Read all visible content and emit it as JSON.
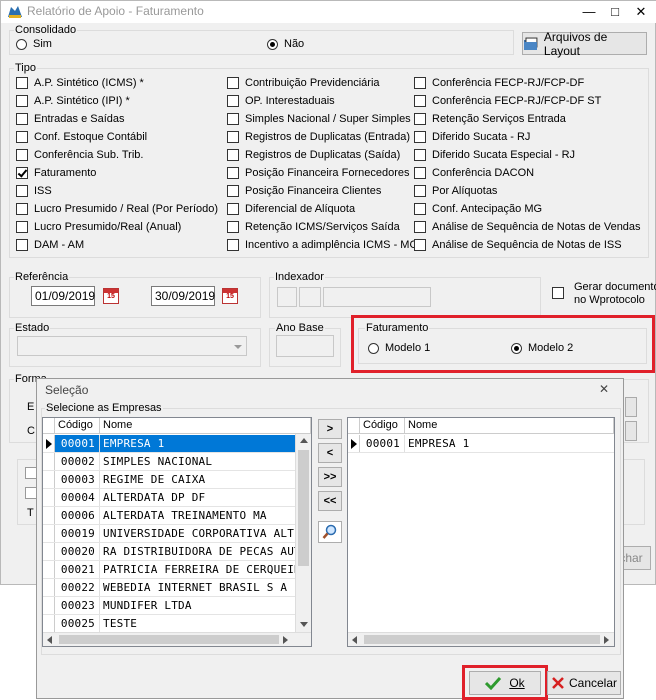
{
  "window": {
    "title": "Relatório de Apoio - Faturamento",
    "minimize": "—",
    "maximize": "□",
    "close": "✕"
  },
  "consolidado": {
    "legend": "Consolidado",
    "sim": "Sim",
    "nao": "Não",
    "selected": "nao"
  },
  "arquivos_button": "Arquivos de Layout",
  "tipo": {
    "legend": "Tipo",
    "col1": [
      {
        "label": "A.P. Sintético (ICMS) *",
        "checked": false
      },
      {
        "label": "A.P. Sintético (IPI) *",
        "checked": false
      },
      {
        "label": "Entradas e Saídas",
        "checked": false
      },
      {
        "label": "Conf. Estoque Contábil",
        "checked": false
      },
      {
        "label": "Conferência Sub. Trib.",
        "checked": false
      },
      {
        "label": "Faturamento",
        "checked": true
      },
      {
        "label": "ISS",
        "checked": false
      },
      {
        "label": "Lucro Presumido / Real (Por  Período)",
        "checked": false
      },
      {
        "label": "Lucro Presumido/Real (Anual)",
        "checked": false
      },
      {
        "label": "DAM - AM",
        "checked": false
      }
    ],
    "col2": [
      {
        "label": "Contribuição Previdenciária",
        "checked": false
      },
      {
        "label": "OP. Interestaduais",
        "checked": false
      },
      {
        "label": "Simples Nacional / Super Simples",
        "checked": false
      },
      {
        "label": "Registros de Duplicatas (Entrada)",
        "checked": false
      },
      {
        "label": "Registros de Duplicatas (Saída)",
        "checked": false
      },
      {
        "label": "Posição Financeira Fornecedores",
        "checked": false
      },
      {
        "label": "Posição Financeira Clientes",
        "checked": false
      },
      {
        "label": "Diferencial de Alíquota",
        "checked": false
      },
      {
        "label": "Retenção ICMS/Serviços Saída",
        "checked": false
      },
      {
        "label": "Incentivo a adimplência ICMS - MG",
        "checked": false
      }
    ],
    "col3": [
      {
        "label": "Conferência FECP-RJ/FCP-DF",
        "checked": false
      },
      {
        "label": "Conferência FECP-RJ/FCP-DF ST",
        "checked": false
      },
      {
        "label": "Retenção Serviços Entrada",
        "checked": false
      },
      {
        "label": "Diferido Sucata - RJ",
        "checked": false
      },
      {
        "label": "Diferido Sucata Especial - RJ",
        "checked": false
      },
      {
        "label": "Conferência DACON",
        "checked": false
      },
      {
        "label": "Por Alíquotas",
        "checked": false
      },
      {
        "label": "Conf. Antecipação MG",
        "checked": false
      },
      {
        "label": "Análise de Sequência de Notas de Vendas",
        "checked": false
      },
      {
        "label": "Análise de Sequência de Notas de ISS",
        "checked": false
      }
    ]
  },
  "referencia": {
    "legend": "Referência",
    "inicio": "01/09/2019",
    "fim": "30/09/2019",
    "cal_label": "15"
  },
  "indexador": {
    "legend": "Indexador"
  },
  "gerar": {
    "line1": "Gerar documento",
    "line2": "no Wprotocolo"
  },
  "estado": {
    "legend": "Estado"
  },
  "ano_base": {
    "legend": "Ano Base"
  },
  "faturamento": {
    "legend": "Faturamento",
    "modelo1": "Modelo 1",
    "modelo2": "Modelo 2",
    "selected": "modelo2"
  },
  "background_fragments": {
    "forma": "Forma",
    "e": "E",
    "c": "C",
    "t": "T",
    "fechar": "char"
  },
  "selecao": {
    "title": "Seleção",
    "close": "✕",
    "group": "Selecione as Empresas",
    "col_codigo": "Código",
    "col_nome": "Nome",
    "left_rows": [
      {
        "codigo": "00001",
        "nome": "EMPRESA 1",
        "selected": true
      },
      {
        "codigo": "00002",
        "nome": "SIMPLES NACIONAL"
      },
      {
        "codigo": "00003",
        "nome": "REGIME DE CAIXA"
      },
      {
        "codigo": "00004",
        "nome": "ALTERDATA DP  DF"
      },
      {
        "codigo": "00006",
        "nome": "ALTERDATA TREINAMENTO MA"
      },
      {
        "codigo": "00019",
        "nome": "UNIVERSIDADE CORPORATIVA ALTE"
      },
      {
        "codigo": "00020",
        "nome": "RA DISTRIBUIDORA DE PECAS AUTO"
      },
      {
        "codigo": "00021",
        "nome": "PATRICIA FERREIRA DE CERQUEIRA"
      },
      {
        "codigo": "00022",
        "nome": "WEBEDIA INTERNET BRASIL S A"
      },
      {
        "codigo": "00023",
        "nome": "MUNDIFER LTDA"
      },
      {
        "codigo": "00025",
        "nome": "TESTE"
      }
    ],
    "right_rows": [
      {
        "codigo": "00001",
        "nome": "EMPRESA 1"
      }
    ],
    "move_buttons": [
      ">",
      "<",
      ">>",
      "<<"
    ],
    "search_icon": "magnifier-icon",
    "ok": "Ok",
    "cancelar": "Cancelar"
  },
  "colors": {
    "highlight": "#e0202a",
    "selection": "#0078d7"
  }
}
